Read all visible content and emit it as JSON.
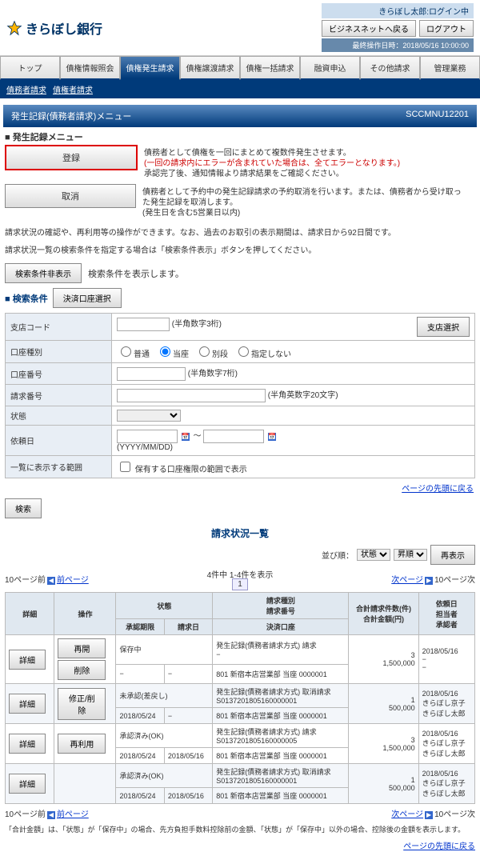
{
  "header": {
    "bank_name": "きらぼし銀行",
    "login_user": "きらぼし太郎:ログイン中",
    "btn_back": "ビジネスネットへ戻る",
    "btn_logout": "ログアウト",
    "last_op": "最終操作日時：2018/05/16 10:00:00"
  },
  "main_tabs": [
    "トップ",
    "債権情報照会",
    "債権発生請求",
    "債権譲渡請求",
    "債権一括請求",
    "融資申込",
    "その他請求",
    "管理業務"
  ],
  "active_tab": 2,
  "sub_tabs": [
    "債務者請求",
    "債権者請求"
  ],
  "menu": {
    "title": "発生記録(債務者請求)メニュー",
    "code": "SCCMNU12201",
    "section": "■ 発生記録メニュー",
    "register_btn": "登録",
    "register_desc1": "債務者として債権を一回にまとめて複数件発生させます。",
    "register_desc2": "(一回の請求内にエラーが含まれていた場合は、全てエラーとなります。)",
    "register_desc3": "承認完了後、通知情報より請求結果をご確認ください。",
    "cancel_btn": "取消",
    "cancel_desc": "債務者として予約中の発生記録請求の予約取消を行います。または、債務者から受け取った発生記録を取消します。\n(発生日を含む5営業日以内)"
  },
  "notes": {
    "n1": "請求状況の確認や、再利用等の操作ができます。なお、過去のお取引の表示期間は、請求日から92日間です。",
    "n2": "請求状況一覧の検索条件を指定する場合は「検索条件表示」ボタンを押してください。"
  },
  "search": {
    "toggle_btn": "検索条件非表示",
    "toggle_note": "検索条件を表示します。",
    "section": "■ 検索条件",
    "acct_select_btn": "決済口座選択",
    "branch_label": "支店コード",
    "branch_hint": "(半角数字3桁)",
    "branch_btn": "支店選択",
    "acct_type_label": "口座種別",
    "acct_types": [
      "普通",
      "当座",
      "別段",
      "指定しない"
    ],
    "acct_no_label": "口座番号",
    "acct_no_hint": "(半角数字7桁)",
    "req_no_label": "請求番号",
    "req_no_hint": "(半角英数字20文字)",
    "status_label": "状態",
    "req_date_label": "依頼日",
    "req_date_hint": "(YYYY/MM/DD)",
    "range_label": "一覧に表示する範囲",
    "range_check": "保有する口座権限の範囲で表示",
    "search_btn": "検索",
    "top_link": "ページの先頭に戻る"
  },
  "list": {
    "title": "請求状況一覧",
    "sort_label": "並び順：",
    "sort_sel1": "状態",
    "sort_sel2": "昇順",
    "redisplay": "再表示",
    "count_info": "4件中 1-4件を表示",
    "page_cur": "1",
    "prev10": "10ページ前",
    "prev": "前ページ",
    "next": "次ページ",
    "next10": "10ページ次",
    "headers": {
      "detail": "詳細",
      "ops": "操作",
      "status": "状態",
      "approval_deadline": "承認期限",
      "req_date": "請求日",
      "req_type": "請求種別\n請求番号",
      "acct": "決済口座",
      "count_amt": "合計請求件数(件)\n合計金額(円)",
      "dep_date": "依頼日\n担当者\n承認者"
    },
    "rows": [
      {
        "ops": [
          "再開",
          "削除"
        ],
        "status": "保存中",
        "deadline": "−",
        "reqdate": "−",
        "reqtype": "発生記録(債務者請求方式) 請求",
        "reqno": "−",
        "acct": "801 新宿本店営業部 当座 0000001",
        "count": "3",
        "amount": "1,500,000",
        "depdate": "2018/05/16",
        "person": "−",
        "approver": "−"
      },
      {
        "ops": [
          "修正/削除"
        ],
        "status": "未承認(差戻し)",
        "deadline": "2018/05/24",
        "reqdate": "−",
        "reqtype": "発生記録(債務者請求方式) 取消請求",
        "reqno": "S0137201805160000001",
        "acct": "801 新宿本店営業部 当座 0000001",
        "count": "1",
        "amount": "500,000",
        "depdate": "2018/05/16",
        "person": "きらぼし京子",
        "approver": "きらぼし太郎"
      },
      {
        "ops": [
          "再利用"
        ],
        "status": "承認済み(OK)",
        "deadline": "2018/05/24",
        "reqdate": "2018/05/16",
        "reqtype": "発生記録(債務者請求方式) 請求",
        "reqno": "S0137201805160000005",
        "acct": "801 新宿本店営業部 当座 0000001",
        "count": "3",
        "amount": "1,500,000",
        "depdate": "2018/05/16",
        "person": "きらぼし京子",
        "approver": "きらぼし太郎"
      },
      {
        "ops": [],
        "status": "承認済み(OK)",
        "deadline": "2018/05/24",
        "reqdate": "2018/05/16",
        "reqtype": "発生記録(債務者請求方式) 取消請求",
        "reqno": "S0137201805160000001",
        "acct": "801 新宿本店営業部 当座 0000001",
        "count": "1",
        "amount": "500,000",
        "depdate": "2018/05/16",
        "person": "きらぼし京子",
        "approver": "きらぼし太郎"
      }
    ],
    "detail_btn": "詳細",
    "footnote": "「合計金額」は、「状態」が「保存中」の場合、先方負担手数料控除前の金額、「状態」が「保存中」以外の場合、控除後の金額を表示します。",
    "bottom_link": "ページの先頭に戻る"
  }
}
